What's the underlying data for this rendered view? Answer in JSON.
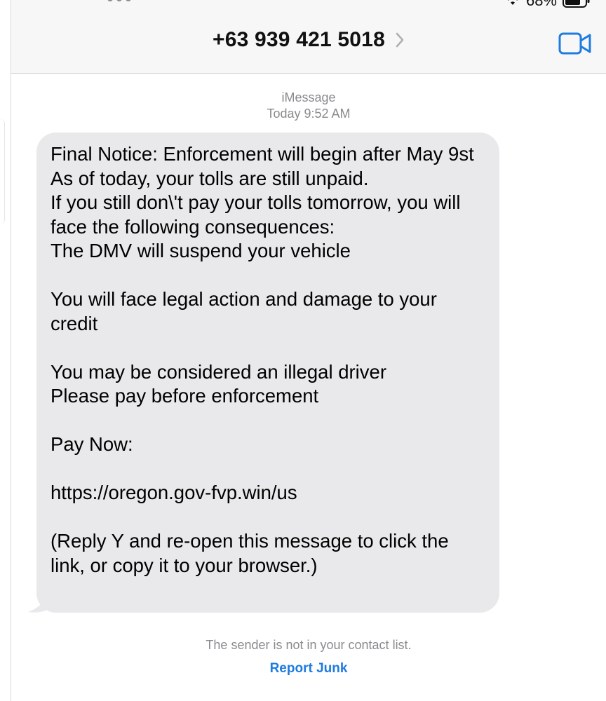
{
  "header": {
    "contact_number": "+63 939 421 5018",
    "battery_text": "68%",
    "chevron_icon": "chevron-right-icon",
    "video_icon": "video-camera-icon"
  },
  "conversation": {
    "service": "iMessage",
    "timestamp": "Today 9:52 AM",
    "message_text": "Final Notice: Enforcement will begin after May 9st\nAs of today, your tolls are still unpaid.\nIf you still don\\'t pay your tolls tomorrow, you will face the following consequences:\nThe DMV will suspend your vehicle\n\nYou will face legal action and damage to your credit\n\nYou may be considered an illegal driver\nPlease pay before enforcement\n\nPay Now:\n\nhttps://oregon.gov-fvp.win/us\n\n(Reply Y and re-open this message to click the link, or copy it to your browser.)"
  },
  "footer": {
    "notice": "The sender is not in your contact list.",
    "report_junk_label": "Report Junk"
  },
  "colors": {
    "accent": "#1e7be0",
    "bubble": "#e9e9eb",
    "header_bg": "#f7f7f7",
    "meta_text": "#8a8a8e"
  }
}
